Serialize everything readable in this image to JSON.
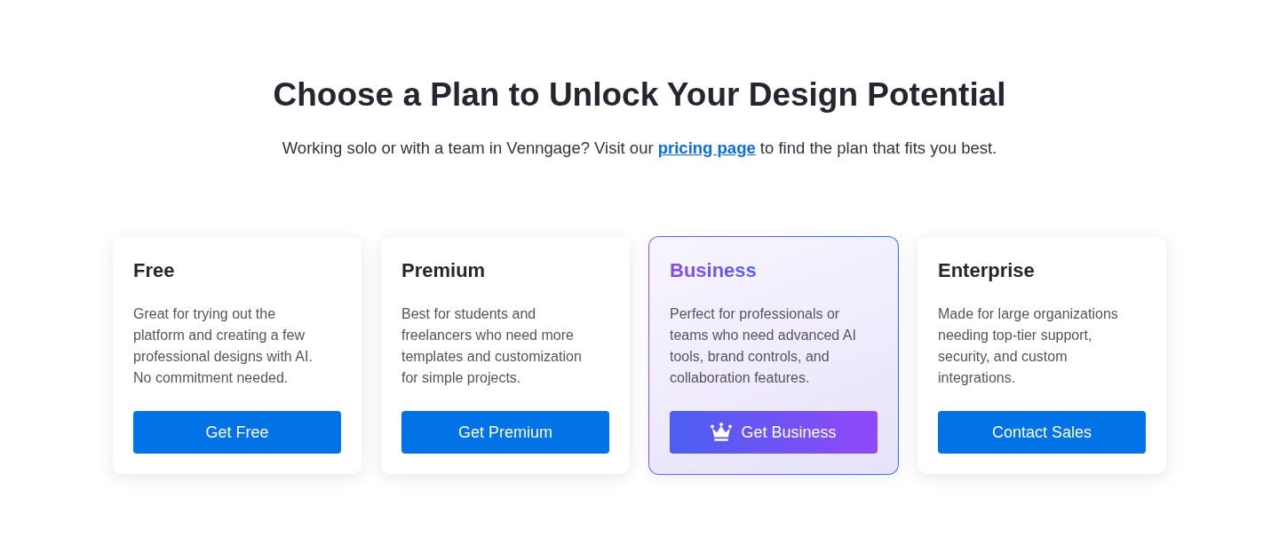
{
  "heading": "Choose a Plan to Unlock Your Design Potential",
  "subtitle": {
    "text_before": "Working solo or with a team in Venngage? Visit our",
    "link": "pricing page",
    "text_after": "to find the plan that fits you best."
  },
  "plans": [
    {
      "name": "Free",
      "description": "Great for trying out the platform and creating a few professional designs with AI. No commitment needed.",
      "button": "Get Free",
      "featured": false
    },
    {
      "name": "Premium",
      "description": "Best for students and freelancers who need more templates and customization for simple projects.",
      "button": "Get Premium",
      "featured": false
    },
    {
      "name": "Business",
      "description": "Perfect for professionals or teams who need advanced AI tools, brand controls, and collaboration features.",
      "button": "Get Business",
      "featured": true
    },
    {
      "name": "Enterprise",
      "description": "Made for large organizations needing top-tier support, security, and custom integrations.",
      "button": "Contact Sales",
      "featured": false
    }
  ]
}
